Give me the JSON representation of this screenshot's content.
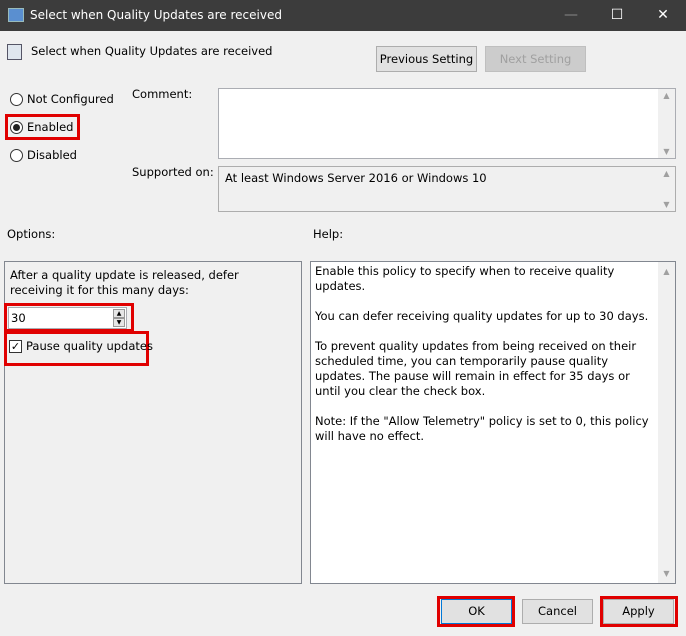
{
  "window": {
    "title": "Select when Quality Updates are received"
  },
  "header": {
    "title": "Select when Quality Updates are received",
    "prev": "Previous Setting",
    "next": "Next Setting"
  },
  "state": {
    "options": [
      "Not Configured",
      "Enabled",
      "Disabled"
    ],
    "selected": "Enabled"
  },
  "comment": {
    "label": "Comment:",
    "value": ""
  },
  "supported": {
    "label": "Supported on:",
    "value": "At least Windows Server 2016 or Windows 10"
  },
  "options": {
    "label": "Options:",
    "defer_text": "After a quality update is released, defer receiving it for this many days:",
    "days": "30",
    "pause_label": "Pause quality updates",
    "pause_checked": true
  },
  "help": {
    "label": "Help:",
    "paragraphs": [
      "Enable this policy to specify when to receive quality updates.",
      "You can defer receiving quality updates for up to 30 days.",
      "To prevent quality updates from being received on their scheduled time, you can temporarily pause quality updates. The pause will remain in effect for 35 days or until you clear the check box.",
      "Note: If the \"Allow Telemetry\" policy is set to 0, this policy will have no effect."
    ]
  },
  "footer": {
    "ok": "OK",
    "cancel": "Cancel",
    "apply": "Apply"
  },
  "colors": {
    "highlight": "#e00000",
    "titlebar": "#3c3c3c"
  }
}
